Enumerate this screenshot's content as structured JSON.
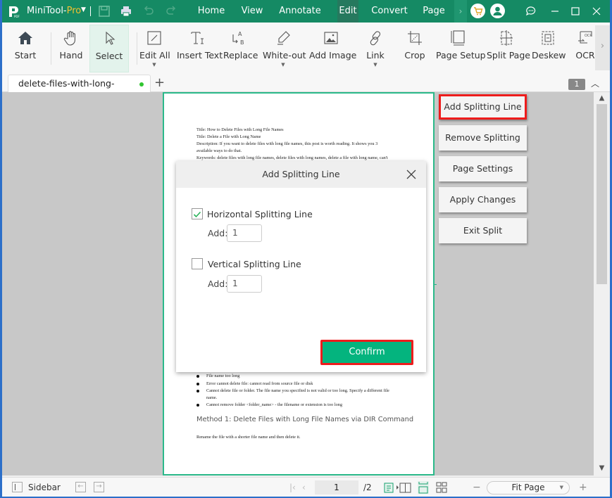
{
  "app": {
    "name": "MiniTool-",
    "edition": "Pro",
    "accent": "#158a64",
    "highlight_color": "#ee1c1c"
  },
  "menus": [
    {
      "label": "Home"
    },
    {
      "label": "View"
    },
    {
      "label": "Annotate"
    },
    {
      "label": "Edit",
      "active": true
    },
    {
      "label": "Convert"
    },
    {
      "label": "Page"
    }
  ],
  "ribbon": {
    "tools": [
      {
        "label": "Start",
        "icon": "home-icon"
      },
      {
        "label": "Hand",
        "icon": "hand-icon"
      },
      {
        "label": "Select",
        "icon": "cursor-icon",
        "selected": true
      },
      {
        "label": "Edit All",
        "icon": "edit-all-icon",
        "dropdown": true
      },
      {
        "label": "Insert Text",
        "icon": "insert-text-icon"
      },
      {
        "label": "Replace",
        "icon": "replace-icon"
      },
      {
        "label": "White-out",
        "icon": "eraser-icon",
        "dropdown": true
      },
      {
        "label": "Add Image",
        "icon": "image-icon"
      },
      {
        "label": "Link",
        "icon": "link-icon",
        "dropdown": true
      },
      {
        "label": "Crop",
        "icon": "crop-icon"
      },
      {
        "label": "Page Setup",
        "icon": "page-setup-icon"
      },
      {
        "label": "Split Page",
        "icon": "split-page-icon"
      },
      {
        "label": "Deskew",
        "icon": "deskew-icon"
      },
      {
        "label": "OCR",
        "icon": "ocr-icon"
      }
    ]
  },
  "tabs": {
    "doc_tab": "delete-files-with-long-file...pdf",
    "page_badge": "1"
  },
  "document": {
    "lines": [
      "Title: How to Delete Files with Long File Names",
      "Title: Delete a File with Long Name",
      "Description: If you want to delete files with long file names, this post is worth reading. It shows you 3",
      "available ways to do that.",
      "Keywords: delete files with long file names, delete files with long names, delete a file with long name, can't"
    ],
    "bullets": [
      "File name too long",
      "Error cannot delete file: cannot read from source file or disk",
      "Cannot delete file or folder. The file name you specified is not valid or too long. Specify a different file",
      "Cannot remove folder <folder_name> - the filename or extension is too long"
    ],
    "bullet_cont": "name.",
    "heading": "Method 1: Delete Files with Long File Names via DIR Command",
    "paragraph": "Rename the file with a shorter file name and then delete it."
  },
  "split_panel": {
    "buttons": [
      {
        "label": "Add Splitting Line",
        "highlighted": true
      },
      {
        "label": "Remove Splitting Line"
      },
      {
        "label": "Page Settings"
      },
      {
        "label": "Apply Changes"
      },
      {
        "label": "Exit Split"
      }
    ]
  },
  "dialog": {
    "title": "Add Splitting Line",
    "horizontal": {
      "label": "Horizontal Splitting Line",
      "checked": true,
      "add_label": "Add:",
      "value": "1"
    },
    "vertical": {
      "label": "Vertical Splitting Line",
      "checked": false,
      "add_label": "Add:",
      "value": "1"
    },
    "confirm": "Confirm"
  },
  "statusbar": {
    "sidebar": "Sidebar",
    "page": "1",
    "total": "/2",
    "zoom": "Fit Page"
  }
}
